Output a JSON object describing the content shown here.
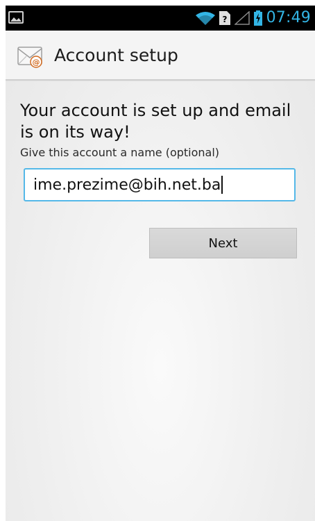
{
  "status_bar": {
    "time": "07:49",
    "icons": [
      "gallery-icon",
      "wifi-icon",
      "no-sim-icon",
      "signal-icon",
      "battery-charging-icon"
    ],
    "accent_color": "#33b5e5"
  },
  "action_bar": {
    "title": "Account setup",
    "app_icon": "email-envelope-icon"
  },
  "main": {
    "heading": "Your account is set up and email is on its way!",
    "name_label": "Give this account a name (optional)",
    "account_name_value": "ime.prezime@bih.net.ba",
    "next_button": "Next"
  },
  "colors": {
    "focus_border": "#54b8e8",
    "status_text": "#33b5e5"
  }
}
